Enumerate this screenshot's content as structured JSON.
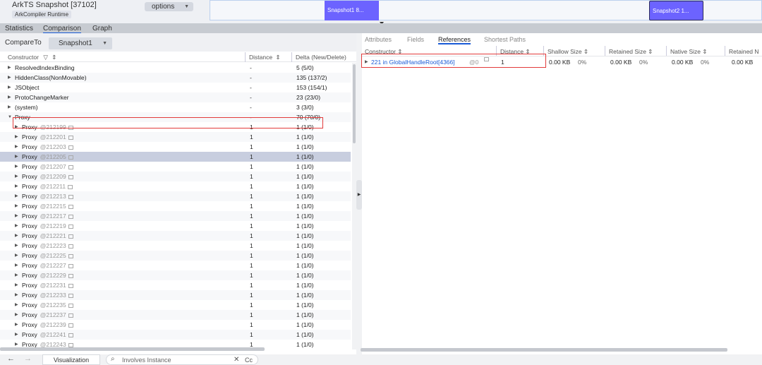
{
  "window": {
    "title": "ArkTS Snapshot [37102]",
    "subtitle": "ArkCompiler Runtime",
    "options_label": "options"
  },
  "timeline": {
    "snapshot1": "Snapshot1 8...",
    "snapshot2": "Snapshot2 1..."
  },
  "left_tabs": [
    "Statistics",
    "Comparison",
    "Graph"
  ],
  "compare": {
    "label": "CompareTo",
    "selected": "Snapshot1"
  },
  "left_columns": [
    "Constructor",
    "Distance",
    "Delta (New/Delete)"
  ],
  "left_rows": [
    {
      "name": "ResolvedIndexBinding",
      "id": "",
      "distance": "-",
      "delta": "5 (5/0)"
    },
    {
      "name": "HiddenClass(NonMovable)",
      "id": "",
      "distance": "-",
      "delta": "135 (137/2)"
    },
    {
      "name": "JSObject",
      "id": "",
      "distance": "-",
      "delta": "153 (154/1)"
    },
    {
      "name": "ProtoChangeMarker",
      "id": "",
      "distance": "-",
      "delta": "23 (23/0)"
    },
    {
      "name": "(system)",
      "id": "",
      "distance": "-",
      "delta": "3 (3/0)"
    },
    {
      "name": "Proxy",
      "id": "",
      "distance": "-",
      "delta": "70 (70/0)"
    },
    {
      "name": "Proxy",
      "id": "@212199",
      "distance": "1",
      "delta": "1 (1/0)"
    },
    {
      "name": "Proxy",
      "id": "@212201",
      "distance": "1",
      "delta": "1 (1/0)"
    },
    {
      "name": "Proxy",
      "id": "@212203",
      "distance": "1",
      "delta": "1 (1/0)"
    },
    {
      "name": "Proxy",
      "id": "@212205",
      "distance": "1",
      "delta": "1 (1/0)"
    },
    {
      "name": "Proxy",
      "id": "@212207",
      "distance": "1",
      "delta": "1 (1/0)"
    },
    {
      "name": "Proxy",
      "id": "@212209",
      "distance": "1",
      "delta": "1 (1/0)"
    },
    {
      "name": "Proxy",
      "id": "@212211",
      "distance": "1",
      "delta": "1 (1/0)"
    },
    {
      "name": "Proxy",
      "id": "@212213",
      "distance": "1",
      "delta": "1 (1/0)"
    },
    {
      "name": "Proxy",
      "id": "@212215",
      "distance": "1",
      "delta": "1 (1/0)"
    },
    {
      "name": "Proxy",
      "id": "@212217",
      "distance": "1",
      "delta": "1 (1/0)"
    },
    {
      "name": "Proxy",
      "id": "@212219",
      "distance": "1",
      "delta": "1 (1/0)"
    },
    {
      "name": "Proxy",
      "id": "@212221",
      "distance": "1",
      "delta": "1 (1/0)"
    },
    {
      "name": "Proxy",
      "id": "@212223",
      "distance": "1",
      "delta": "1 (1/0)"
    },
    {
      "name": "Proxy",
      "id": "@212225",
      "distance": "1",
      "delta": "1 (1/0)"
    },
    {
      "name": "Proxy",
      "id": "@212227",
      "distance": "1",
      "delta": "1 (1/0)"
    },
    {
      "name": "Proxy",
      "id": "@212229",
      "distance": "1",
      "delta": "1 (1/0)"
    },
    {
      "name": "Proxy",
      "id": "@212231",
      "distance": "1",
      "delta": "1 (1/0)"
    },
    {
      "name": "Proxy",
      "id": "@212233",
      "distance": "1",
      "delta": "1 (1/0)"
    },
    {
      "name": "Proxy",
      "id": "@212235",
      "distance": "1",
      "delta": "1 (1/0)"
    },
    {
      "name": "Proxy",
      "id": "@212237",
      "distance": "1",
      "delta": "1 (1/0)"
    },
    {
      "name": "Proxy",
      "id": "@212239",
      "distance": "1",
      "delta": "1 (1/0)"
    },
    {
      "name": "Proxy",
      "id": "@212241",
      "distance": "1",
      "delta": "1 (1/0)"
    },
    {
      "name": "Proxy",
      "id": "@212243",
      "distance": "1",
      "delta": "1 (1/0)"
    }
  ],
  "right_tabs": [
    "Attributes",
    "Fields",
    "References",
    "Shortest Paths"
  ],
  "right_columns": [
    "Constructor",
    "Distance",
    "Shallow Size",
    "Retained Size",
    "Native Size",
    "Retained N"
  ],
  "reference_row": {
    "name": "221 in GlobalHandleRoot[4366]",
    "id": "@0",
    "distance": "1",
    "shallow": "0.00 KB",
    "shallow_pct": "0%",
    "retained": "0.00 KB",
    "retained_pct": "0%",
    "native": "0.00 KB",
    "native_pct": "0%",
    "retained_n": "0.00 KB"
  },
  "bottom": {
    "visualization_tab": "Visualization",
    "search_placeholder": "Involves Instance",
    "case_label": "Cc"
  },
  "colors": {
    "accent": "#1a5bd7",
    "snapshot": "#6c63ff",
    "highlight": "#e23b3b",
    "selected_row": "#c8cedf"
  }
}
